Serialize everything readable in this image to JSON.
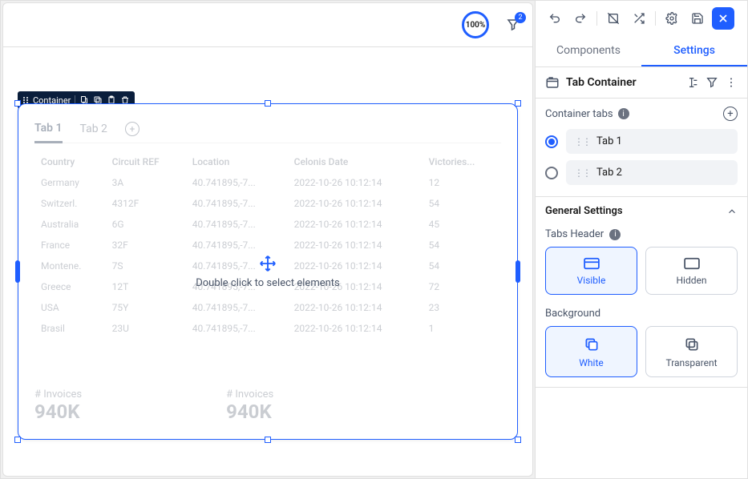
{
  "topbar": {
    "zoom": "100%",
    "filter_count": "2"
  },
  "selection_chip": {
    "label": "Container"
  },
  "overlay": {
    "hint": "Double click to select elements"
  },
  "tabs": {
    "tab1": "Tab 1",
    "tab2": "Tab 2"
  },
  "table": {
    "headers": [
      "Country",
      "Circuit REF",
      "Location",
      "Celonis Date",
      "Victories..."
    ],
    "rows": [
      [
        "Germany",
        "3A",
        "40.741895,-7...",
        "2022-10-26 10:12:14",
        "12"
      ],
      [
        "Switzerl.",
        "4312F",
        "40.741895,-7...",
        "2022-10-26 10:12:14",
        "54"
      ],
      [
        "Australia",
        "6G",
        "40.741895,-7...",
        "2022-10-26 10:12:14",
        "45"
      ],
      [
        "France",
        "32F",
        "40.741895,-7...",
        "2022-10-26 10:12:14",
        "54"
      ],
      [
        "Montene.",
        "7S",
        "40.741895,-7...",
        "2022-10-26 10:12:14",
        "54"
      ],
      [
        "Greece",
        "12T",
        "40.741895,-7...",
        "2022-10-26 10:12:14",
        "72"
      ],
      [
        "USA",
        "75Y",
        "40.741895,-7...",
        "2022-10-26 10:12:14",
        "23"
      ],
      [
        "Brasil",
        "23U",
        "40.741895,-7...",
        "2022-10-26 10:12:14",
        "1"
      ]
    ]
  },
  "kpi": {
    "label": "# Invoices",
    "value": "940K"
  },
  "panel": {
    "tabs": {
      "components": "Components",
      "settings": "Settings"
    },
    "title": "Tab Container",
    "container_tabs_label": "Container tabs",
    "container_tabs": [
      "Tab 1",
      "Tab 2"
    ],
    "general_settings": "General Settings",
    "tabs_header_label": "Tabs Header",
    "tabs_header_options": {
      "visible": "Visible",
      "hidden": "Hidden"
    },
    "background_label": "Background",
    "background_options": {
      "white": "White",
      "transparent": "Transparent"
    }
  }
}
